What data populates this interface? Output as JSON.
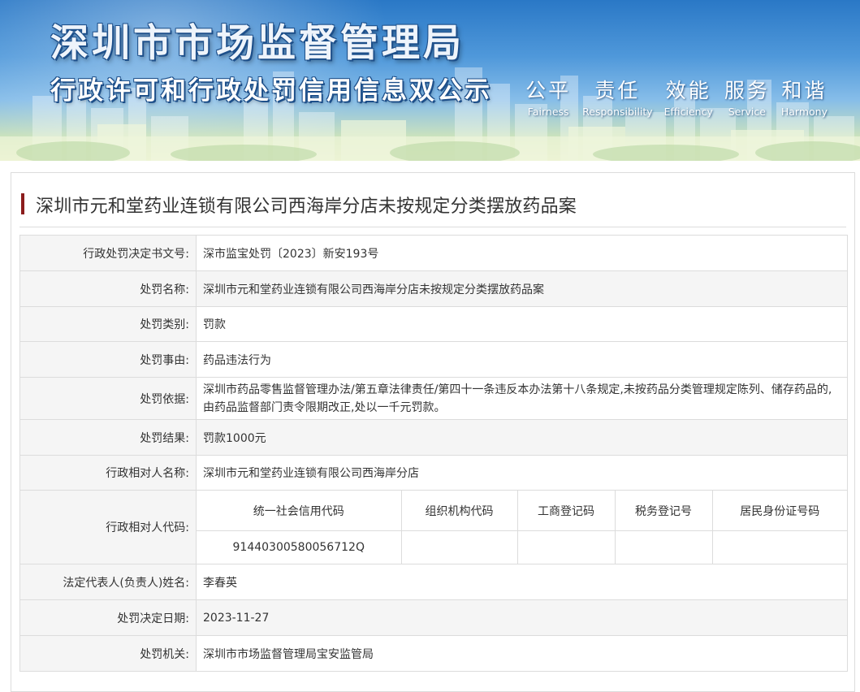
{
  "header": {
    "title": "深圳市市场监督管理局",
    "subtitle": "行政许可和行政处罚信用信息双公示",
    "slogans": [
      {
        "cn": "公平",
        "en": "Fairness"
      },
      {
        "cn": "责任",
        "en": "Responsibility"
      },
      {
        "cn": "效能",
        "en": "Efficiency"
      },
      {
        "cn": "服务",
        "en": "Service"
      },
      {
        "cn": "和谐",
        "en": "Harmony"
      }
    ]
  },
  "case": {
    "title": "深圳市元和堂药业连锁有限公司西海岸分店未按规定分类摆放药品案",
    "fields": {
      "decision_no": {
        "label": "行政处罚决定书文号:",
        "value": "深市监宝处罚〔2023〕新安193号"
      },
      "penalty_name": {
        "label": "处罚名称:",
        "value": "深圳市元和堂药业连锁有限公司西海岸分店未按规定分类摆放药品案"
      },
      "penalty_type": {
        "label": "处罚类别:",
        "value": "罚款"
      },
      "penalty_reason": {
        "label": "处罚事由:",
        "value": "药品违法行为"
      },
      "penalty_basis": {
        "label": "处罚依据:",
        "value": "深圳市药品零售监督管理办法/第五章法律责任/第四十一条违反本办法第十八条规定,未按药品分类管理规定陈列、储存药品的,由药品监督部门责令限期改正,处以一千元罚款。"
      },
      "penalty_result": {
        "label": "处罚结果:",
        "value": "罚款1000元"
      },
      "party_name": {
        "label": "行政相对人名称:",
        "value": "深圳市元和堂药业连锁有限公司西海岸分店"
      },
      "party_code": {
        "label": "行政相对人代码:",
        "headers": [
          "统一社会信用代码",
          "组织机构代码",
          "工商登记码",
          "税务登记号",
          "居民身份证号码"
        ],
        "values": [
          "91440300580056712Q",
          "",
          "",
          "",
          ""
        ]
      },
      "legal_rep": {
        "label": "法定代表人(负责人)姓名:",
        "value": "李春英"
      },
      "decision_date": {
        "label": "处罚决定日期:",
        "value": "2023-11-27"
      },
      "authority": {
        "label": "处罚机关:",
        "value": "深圳市市场监督管理局宝安监管局"
      }
    }
  },
  "colors": {
    "banner_top": "#2a78c6",
    "title_bar": "#8c1d1d",
    "label_bg": "#f5f5f5",
    "border": "#dcdcdc"
  }
}
